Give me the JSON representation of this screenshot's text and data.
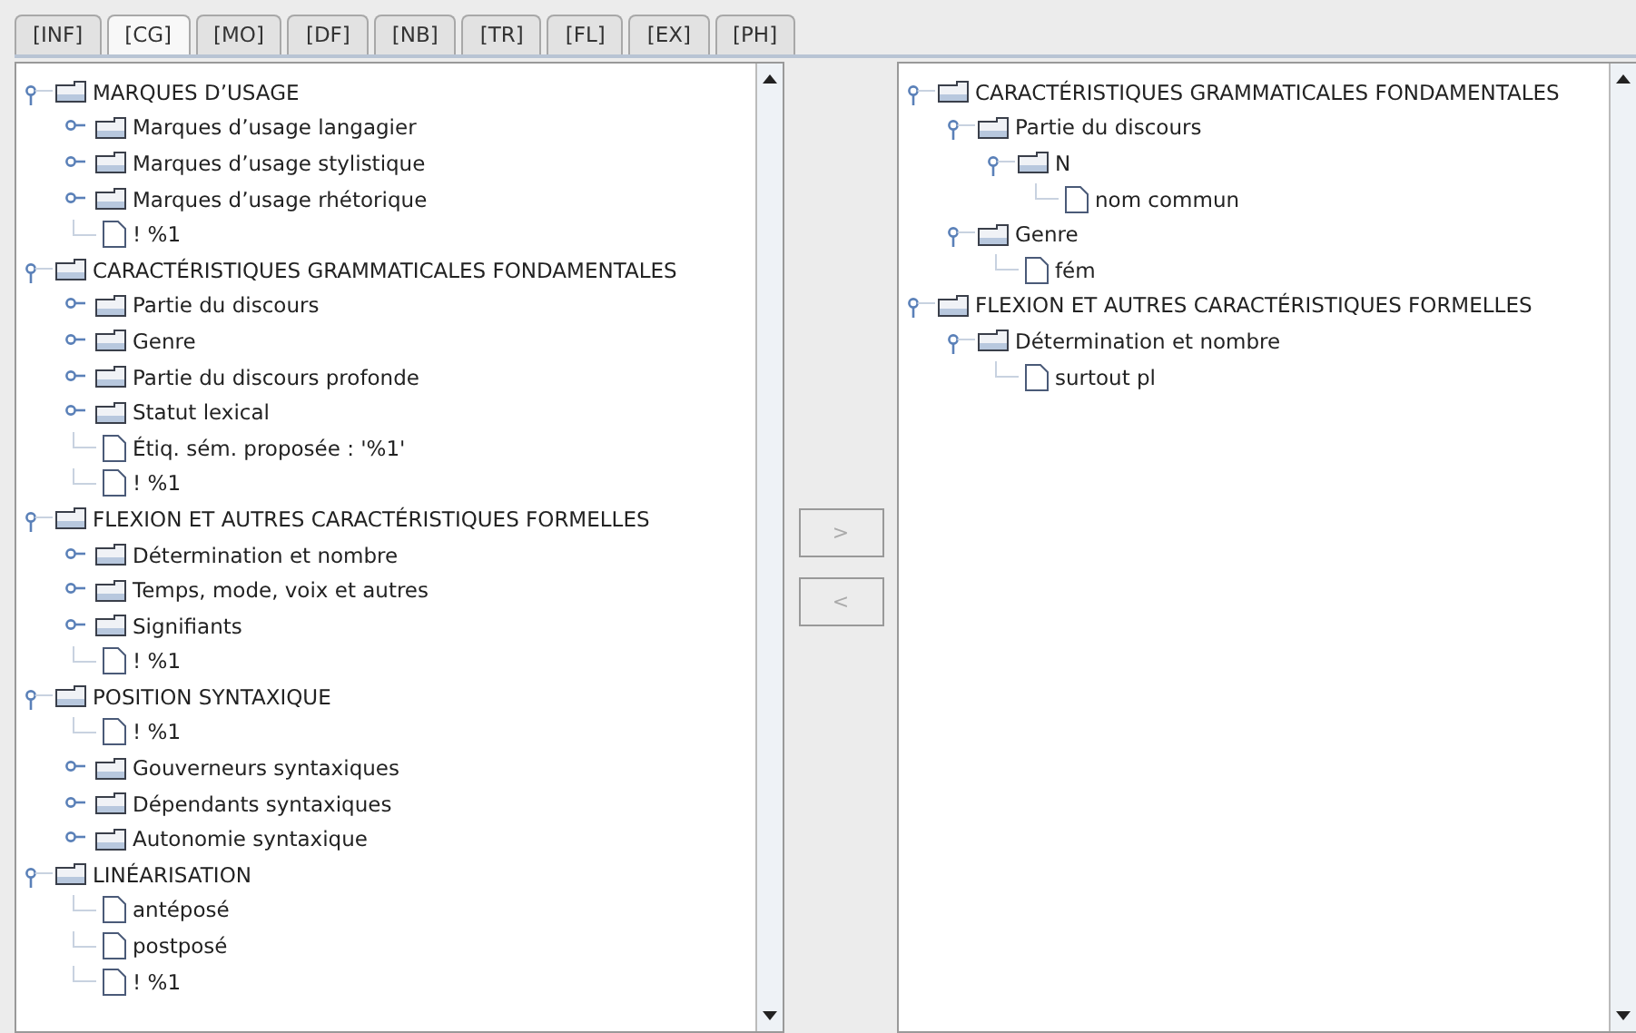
{
  "tabs": [
    {
      "label": "[INF]",
      "selected": false
    },
    {
      "label": "[CG]",
      "selected": true
    },
    {
      "label": "[MO]",
      "selected": false
    },
    {
      "label": "[DF]",
      "selected": false
    },
    {
      "label": "[NB]",
      "selected": false
    },
    {
      "label": "[TR]",
      "selected": false
    },
    {
      "label": "[FL]",
      "selected": false
    },
    {
      "label": "[EX]",
      "selected": false
    },
    {
      "label": "[PH]",
      "selected": false
    }
  ],
  "left_tree": [
    {
      "label": "MARQUES D’USAGE",
      "kind": "folder",
      "expanded": true,
      "children": [
        {
          "label": "Marques d’usage langagier",
          "kind": "folder",
          "expanded": false
        },
        {
          "label": "Marques d’usage stylistique",
          "kind": "folder",
          "expanded": false
        },
        {
          "label": "Marques d’usage rhétorique",
          "kind": "folder",
          "expanded": false
        },
        {
          "label": "! %1",
          "kind": "file"
        }
      ]
    },
    {
      "label": "CARACTÉRISTIQUES GRAMMATICALES FONDAMENTALES",
      "kind": "folder",
      "expanded": true,
      "children": [
        {
          "label": "Partie du discours",
          "kind": "folder",
          "expanded": false
        },
        {
          "label": "Genre",
          "kind": "folder",
          "expanded": false
        },
        {
          "label": "Partie du discours profonde",
          "kind": "folder",
          "expanded": false
        },
        {
          "label": "Statut lexical",
          "kind": "folder",
          "expanded": false
        },
        {
          "label": "Étiq. sém. proposée : '%1'",
          "kind": "file"
        },
        {
          "label": "! %1",
          "kind": "file"
        }
      ]
    },
    {
      "label": "FLEXION ET AUTRES CARACTÉRISTIQUES FORMELLES",
      "kind": "folder",
      "expanded": true,
      "children": [
        {
          "label": "Détermination et nombre",
          "kind": "folder",
          "expanded": false
        },
        {
          "label": "Temps, mode, voix et autres",
          "kind": "folder",
          "expanded": false
        },
        {
          "label": "Signifiants",
          "kind": "folder",
          "expanded": false
        },
        {
          "label": "! %1",
          "kind": "file"
        }
      ]
    },
    {
      "label": "POSITION SYNTAXIQUE",
      "kind": "folder",
      "expanded": true,
      "children": [
        {
          "label": "! %1",
          "kind": "file"
        },
        {
          "label": "Gouverneurs syntaxiques",
          "kind": "folder",
          "expanded": false
        },
        {
          "label": "Dépendants syntaxiques",
          "kind": "folder",
          "expanded": false
        },
        {
          "label": "Autonomie syntaxique",
          "kind": "folder",
          "expanded": false
        }
      ]
    },
    {
      "label": "LINÉARISATION",
      "kind": "folder",
      "expanded": true,
      "children": [
        {
          "label": "antéposé",
          "kind": "file"
        },
        {
          "label": "postposé",
          "kind": "file"
        },
        {
          "label": "! %1",
          "kind": "file"
        }
      ]
    }
  ],
  "move_buttons": [
    {
      "label": ">",
      "disabled": true
    },
    {
      "label": "<",
      "disabled": true
    }
  ],
  "right_tree": [
    {
      "label": "CARACTÉRISTIQUES GRAMMATICALES FONDAMENTALES",
      "kind": "folder",
      "expanded": true,
      "children": [
        {
          "label": "Partie du discours",
          "kind": "folder",
          "expanded": true,
          "children": [
            {
              "label": "N",
              "kind": "folder",
              "expanded": true,
              "children": [
                {
                  "label": "nom commun",
                  "kind": "file"
                }
              ]
            }
          ]
        },
        {
          "label": "Genre",
          "kind": "folder",
          "expanded": true,
          "children": [
            {
              "label": "fém",
              "kind": "file"
            }
          ]
        }
      ]
    },
    {
      "label": "FLEXION ET AUTRES CARACTÉRISTIQUES FORMELLES",
      "kind": "folder",
      "expanded": true,
      "children": [
        {
          "label": "Détermination et nombre",
          "kind": "folder",
          "expanded": true,
          "children": [
            {
              "label": "surtout pl",
              "kind": "file"
            }
          ]
        }
      ]
    }
  ]
}
